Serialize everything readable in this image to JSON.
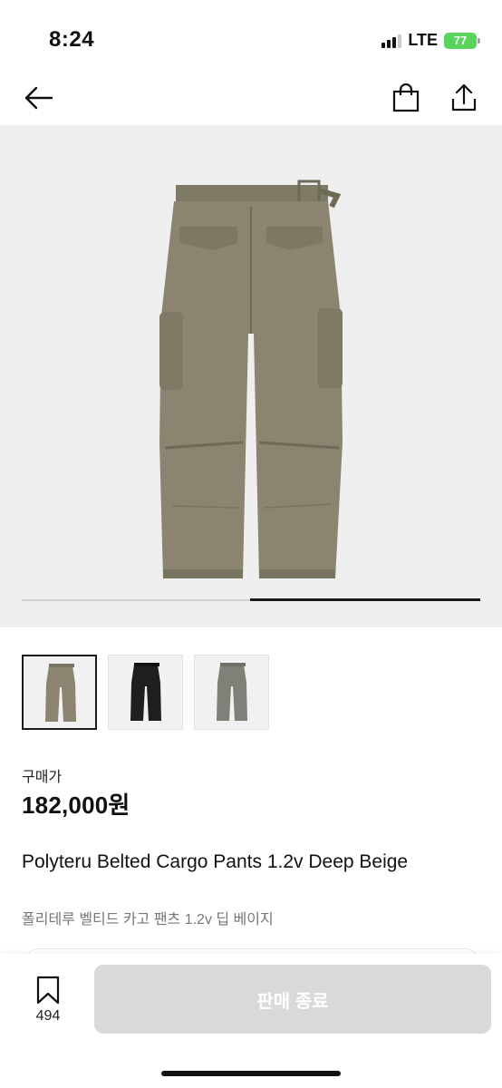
{
  "status_bar": {
    "time": "8:24",
    "network": "LTE",
    "battery": "77"
  },
  "nav": {
    "back_icon": "arrow-left-icon",
    "bag_icon": "shopping-bag-icon",
    "share_icon": "share-icon"
  },
  "gallery": {
    "current_index": 2,
    "total": 2,
    "thumbnails": [
      {
        "label": "deep-beige",
        "color": "#8a8470",
        "selected": true
      },
      {
        "label": "black",
        "color": "#1f1f1f",
        "selected": false
      },
      {
        "label": "gray",
        "color": "#808078",
        "selected": false
      }
    ]
  },
  "product": {
    "price_label": "구매가",
    "price": "182,000원",
    "title_en": "Polyteru Belted Cargo Pants 1.2v Deep Beige",
    "title_ko": "폴리테루 벨티드 카고 팬츠 1.2v 딥 베이지"
  },
  "bottom_bar": {
    "wish_count": "494",
    "button_label": "판매 종료"
  },
  "colors": {
    "accent": "#1a1a1a",
    "disabled_button": "#d9d9d9",
    "battery": "#5ad35c",
    "pants": "#8a8470"
  }
}
